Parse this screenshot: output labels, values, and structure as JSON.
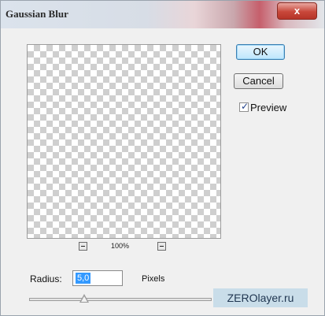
{
  "window": {
    "title": "Gaussian Blur",
    "close_label": "x"
  },
  "buttons": {
    "ok_label": "OK",
    "cancel_label": "Cancel"
  },
  "preview": {
    "checkbox_label": "Preview",
    "checked": true,
    "zoom_level": "100%"
  },
  "radius": {
    "label": "Radius:",
    "value": "5,0",
    "unit": "Pixels"
  },
  "watermark": "ZEROlayer.ru"
}
